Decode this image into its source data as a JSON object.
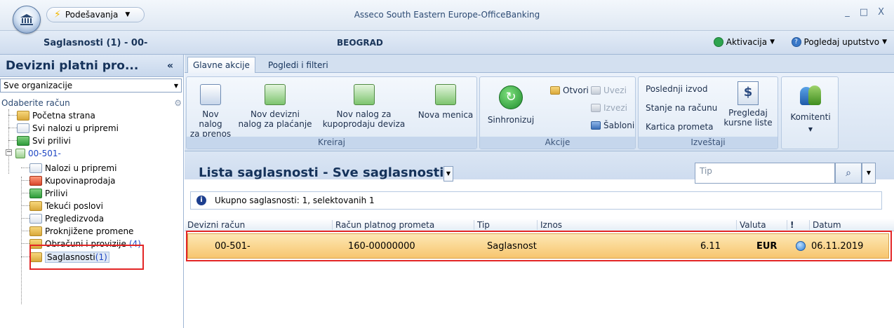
{
  "titlebar": {
    "quick_menu_label": "Podešavanja",
    "app_title": "Asseco South Eastern Europe-OfficeBanking",
    "minimize": "_",
    "maximize": "□",
    "close": "X"
  },
  "infobar": {
    "breadcrumb": "Saglasnosti (1) - 00-",
    "city": "BEOGRAD",
    "activation_label": "Aktivacija",
    "help_label": "Pogledaj uputstvo"
  },
  "left_panel": {
    "title": "Devizni platni pro...",
    "collapse": "«",
    "org_select_value": "Sve organizacije",
    "account_label": "Odaberite račun",
    "tree": [
      {
        "label": "Početna strana",
        "count": ""
      },
      {
        "label": "Svi nalozi u pripremi",
        "count": ""
      },
      {
        "label": "Svi prilivi",
        "count": ""
      },
      {
        "label": "00-501-",
        "count": ""
      },
      {
        "label": "Nalozi u pripremi",
        "count": ""
      },
      {
        "label": "Kupovinaprodaja",
        "count": ""
      },
      {
        "label": "Prilivi",
        "count": ""
      },
      {
        "label": "Tekući poslovi",
        "count": ""
      },
      {
        "label": "Pregledizvoda",
        "count": ""
      },
      {
        "label": "Proknjižene promene",
        "count": ""
      },
      {
        "label": "Obračuni i provizije",
        "count": "(4)"
      },
      {
        "label": "Saglasnosti",
        "count": "(1)"
      }
    ]
  },
  "ribbon": {
    "tabs": [
      "Glavne akcije",
      "Pogledi i filteri"
    ],
    "kreiraj": {
      "label": "Kreiraj",
      "buttons": [
        {
          "line1": "Nov nalog",
          "line2": "za prenos"
        },
        {
          "line1": "Nov devizni",
          "line2": "nalog za plaćanje"
        },
        {
          "line1": "Nov nalog za",
          "line2": "kupoprodaju deviza"
        },
        {
          "line1": "Nova menica",
          "line2": ""
        }
      ]
    },
    "akcije": {
      "label": "Akcije",
      "sync": "Sinhronizuj",
      "otvori": "Otvori",
      "uvezi": "Uvezi",
      "izvezi": "Izvezi",
      "sabloni": "Šabloni"
    },
    "izvestaji": {
      "label": "Izveštaji",
      "poslednji": "Poslednji izvod",
      "stanje": "Stanje na računu",
      "kartica": "Kartica prometa",
      "kursne_line1": "Pregledaj",
      "kursne_line2": "kursne liste"
    },
    "komitenti": {
      "label": "Komitenti"
    }
  },
  "content": {
    "list_title": "Lista saglasnosti - Sve saglasnosti",
    "search_placeholder": "Tip",
    "summary": "Ukupno saglasnosti: 1, selektovanih 1",
    "columns": [
      "Devizni račun",
      "Račun platnog prometa",
      "Tip",
      "Iznos",
      "Valuta",
      "!",
      "Datum"
    ],
    "rows": [
      {
        "devizni_racun": "00-501-",
        "racun_pp": "160-00000000",
        "tip": "Saglasnost",
        "iznos": "6.11",
        "valuta": "EUR",
        "datum": "06.11.2019"
      }
    ]
  },
  "colors": {
    "highlight_red": "#e32626",
    "row_selected": "#f7c66f",
    "header_blue": "#15325a"
  }
}
